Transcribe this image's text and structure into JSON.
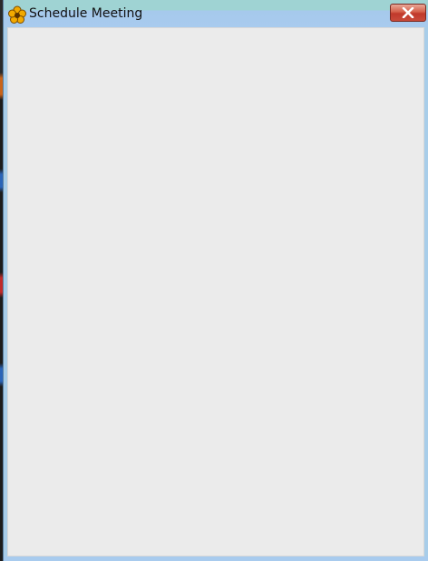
{
  "window": {
    "title": "Schedule Meeting",
    "icon": "flower-app-icon",
    "close_icon": "close-icon"
  },
  "colors": {
    "titlebar": "#a8cbee",
    "client_background": "#ebebeb",
    "close_button": "#c94a3a"
  }
}
